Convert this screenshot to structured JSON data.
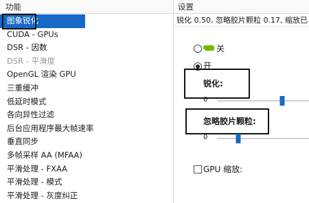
{
  "header": {
    "left_title": "功能",
    "right_title": "设置"
  },
  "features": [
    {
      "label": "图象锐化",
      "state": "selected"
    },
    {
      "label": "CUDA - GPUs",
      "state": "normal"
    },
    {
      "label": "DSR - 因数",
      "state": "normal"
    },
    {
      "label": "DSR - 平滑度",
      "state": "disabled"
    },
    {
      "label": "OpenGL 渲染 GPU",
      "state": "normal"
    },
    {
      "label": "三重缓冲",
      "state": "normal"
    },
    {
      "label": "低延时模式",
      "state": "normal"
    },
    {
      "label": "各向异性过滤",
      "state": "normal"
    },
    {
      "label": "后台应用程序最大帧速率",
      "state": "normal"
    },
    {
      "label": "垂直同步",
      "state": "normal"
    },
    {
      "label": "多帧采样 AA (MFAA)",
      "state": "normal"
    },
    {
      "label": "平滑处理 - FXAA",
      "state": "normal"
    },
    {
      "label": "平滑处理 - 模式",
      "state": "normal"
    },
    {
      "label": "平滑处理 - 灰度纠正",
      "state": "normal"
    }
  ],
  "settings": {
    "status_line": "锐化 0.50, 忽略胶片颗粒 0.17, 缩放已",
    "radio_off": {
      "label": "关",
      "checked": false
    },
    "radio_on": {
      "label": "开",
      "checked": true
    },
    "sharpen": {
      "label": "锐化:",
      "min_label": "0",
      "value_fraction": 0.71
    },
    "grain": {
      "label": "忽略胶片颗粒:",
      "min_label": "0",
      "value_fraction": 0.23
    },
    "gpu_scaling": {
      "label": "GPU 缩放:",
      "checked": false
    }
  },
  "colors": {
    "selection": "#1769c7",
    "nvidia_green": "#76b900",
    "slider_thumb": "#1769c7"
  },
  "icons": {
    "radio_off_badge": "nvidia-eye-icon"
  }
}
